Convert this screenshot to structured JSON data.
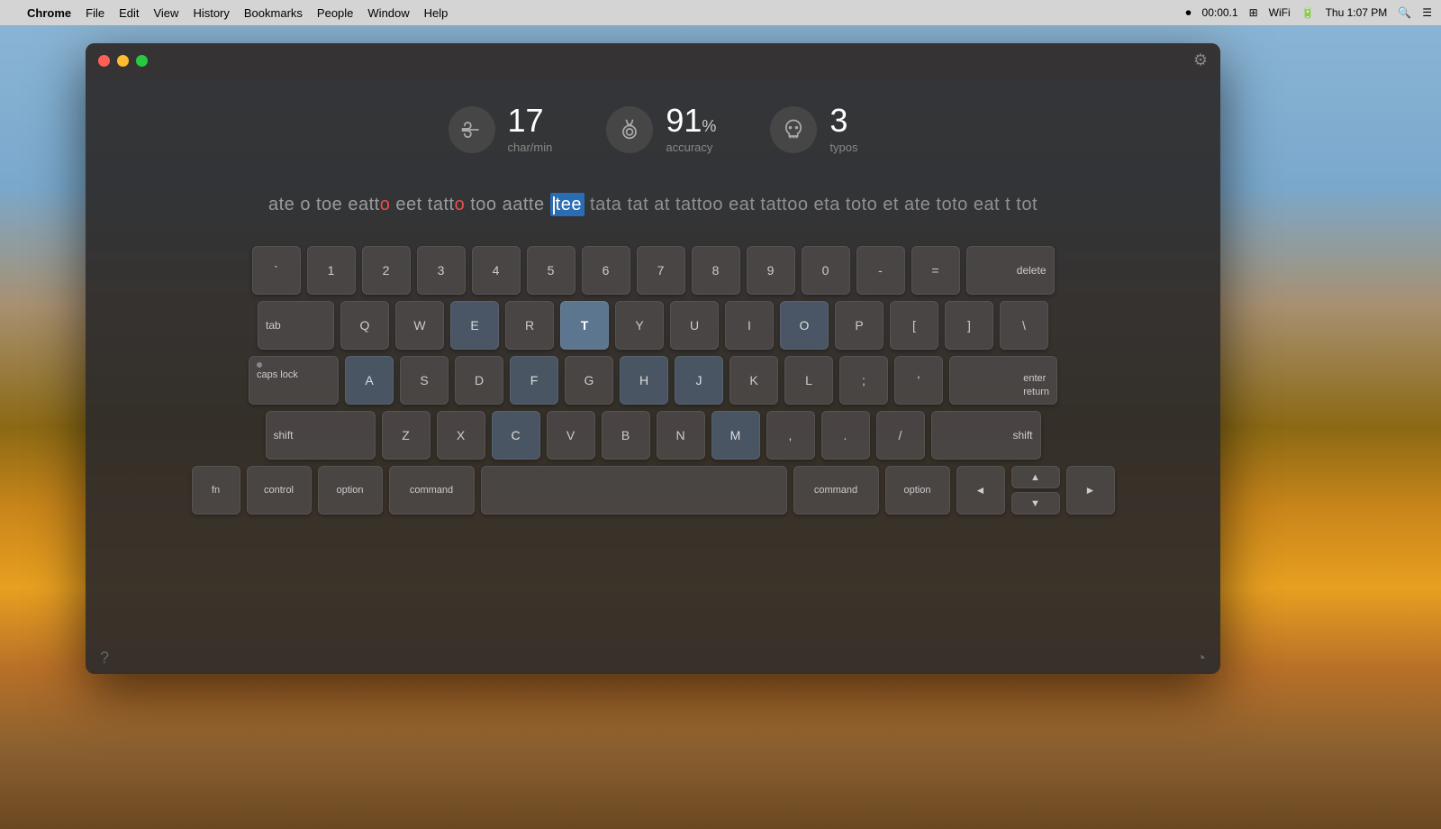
{
  "menubar": {
    "apple": "",
    "app_name": "Chrome",
    "items": [
      "File",
      "Edit",
      "View",
      "History",
      "Bookmarks",
      "People",
      "Window",
      "Help"
    ],
    "right": {
      "recording_time": "00:00.1",
      "datetime": "Thu 1:07 PM"
    }
  },
  "window": {
    "title": "",
    "controls": {
      "close": "close",
      "minimize": "minimize",
      "maximize": "maximize"
    },
    "gear_label": "⚙"
  },
  "stats": {
    "speed": {
      "value": "17",
      "unit": "",
      "label": "char/min"
    },
    "accuracy": {
      "value": "91",
      "unit": "%",
      "label": "accuracy"
    },
    "typos": {
      "value": "3",
      "unit": "",
      "label": "typos"
    }
  },
  "typing": {
    "completed_text": "ate o toe eatto eet tatto too aatte",
    "current_word": "tee",
    "upcoming_text": "tata tat at tattoo eat tattoo eta toto et ate toto eat t tot",
    "error_positions": [
      4,
      5
    ]
  },
  "keyboard": {
    "rows": [
      {
        "id": "numbers",
        "keys": [
          {
            "label": "`",
            "id": "backtick"
          },
          {
            "label": "1",
            "id": "1"
          },
          {
            "label": "2",
            "id": "2"
          },
          {
            "label": "3",
            "id": "3"
          },
          {
            "label": "4",
            "id": "4"
          },
          {
            "label": "5",
            "id": "5"
          },
          {
            "label": "6",
            "id": "6"
          },
          {
            "label": "7",
            "id": "7"
          },
          {
            "label": "8",
            "id": "8"
          },
          {
            "label": "9",
            "id": "9"
          },
          {
            "label": "0",
            "id": "0"
          },
          {
            "label": "-",
            "id": "minus"
          },
          {
            "label": "=",
            "id": "equals"
          },
          {
            "label": "delete",
            "id": "delete",
            "wide": "del"
          }
        ]
      },
      {
        "id": "qwerty",
        "keys": [
          {
            "label": "tab",
            "id": "tab",
            "wide": "tab"
          },
          {
            "label": "Q",
            "id": "q"
          },
          {
            "label": "W",
            "id": "w"
          },
          {
            "label": "E",
            "id": "e",
            "highlighted": true
          },
          {
            "label": "R",
            "id": "r"
          },
          {
            "label": "T",
            "id": "t",
            "active": true
          },
          {
            "label": "Y",
            "id": "y"
          },
          {
            "label": "U",
            "id": "u"
          },
          {
            "label": "I",
            "id": "i"
          },
          {
            "label": "O",
            "id": "o",
            "highlighted": true
          },
          {
            "label": "P",
            "id": "p"
          },
          {
            "label": "[",
            "id": "lbracket"
          },
          {
            "label": "]",
            "id": "rbracket"
          },
          {
            "label": "\\",
            "id": "backslash"
          }
        ]
      },
      {
        "id": "asdf",
        "keys": [
          {
            "label": "caps lock",
            "id": "capslock",
            "wide": "caps"
          },
          {
            "label": "A",
            "id": "a",
            "highlighted": true
          },
          {
            "label": "S",
            "id": "s"
          },
          {
            "label": "D",
            "id": "d"
          },
          {
            "label": "F",
            "id": "f",
            "highlighted": true
          },
          {
            "label": "G",
            "id": "g"
          },
          {
            "label": "H",
            "id": "h",
            "highlighted": true
          },
          {
            "label": "J",
            "id": "j",
            "highlighted": true
          },
          {
            "label": "K",
            "id": "k"
          },
          {
            "label": "L",
            "id": "l"
          },
          {
            "label": ";",
            "id": "semicolon"
          },
          {
            "label": "'",
            "id": "quote"
          },
          {
            "label": "enter\nreturn",
            "id": "enter",
            "wide": "enter"
          }
        ]
      },
      {
        "id": "zxcv",
        "keys": [
          {
            "label": "shift",
            "id": "shift-l",
            "wide": "shift-l"
          },
          {
            "label": "Z",
            "id": "z"
          },
          {
            "label": "X",
            "id": "x"
          },
          {
            "label": "C",
            "id": "c",
            "highlighted": true
          },
          {
            "label": "V",
            "id": "v"
          },
          {
            "label": "B",
            "id": "b"
          },
          {
            "label": "N",
            "id": "n"
          },
          {
            "label": "M",
            "id": "m",
            "highlighted": true
          },
          {
            "label": ",",
            "id": "comma"
          },
          {
            "label": ".",
            "id": "period"
          },
          {
            "label": "/",
            "id": "slash"
          },
          {
            "label": "shift",
            "id": "shift-r",
            "wide": "shift-r"
          }
        ]
      },
      {
        "id": "bottom",
        "keys": [
          {
            "label": "fn",
            "id": "fn",
            "wide": "fn"
          },
          {
            "label": "control",
            "id": "control",
            "wide": "control"
          },
          {
            "label": "option",
            "id": "option-l",
            "wide": "option"
          },
          {
            "label": "command",
            "id": "command-l",
            "wide": "command"
          },
          {
            "label": "",
            "id": "space",
            "wide": "space"
          },
          {
            "label": "command",
            "id": "command-r",
            "wide": "command-r"
          },
          {
            "label": "option",
            "id": "option-r",
            "wide": "option-r"
          },
          {
            "label": "◄",
            "id": "arrow-left"
          },
          {
            "label": "▲▼",
            "id": "arrow-ud"
          },
          {
            "label": "►",
            "id": "arrow-right"
          }
        ]
      }
    ]
  },
  "bottom_bar": {
    "help": "?",
    "stats": "◔"
  }
}
